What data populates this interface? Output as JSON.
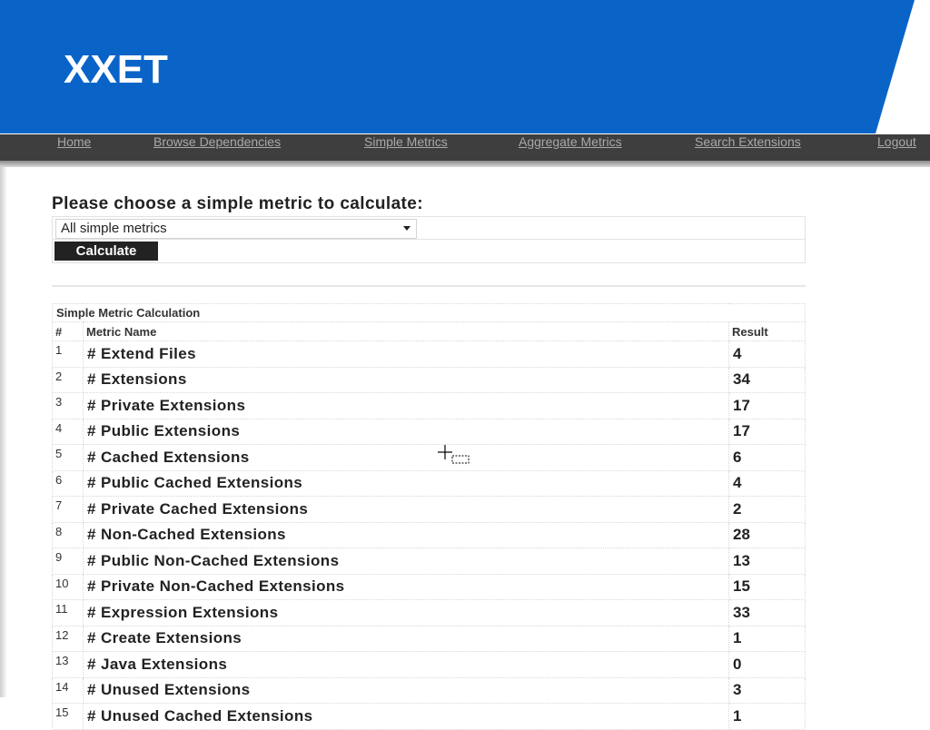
{
  "header": {
    "title": "XXET",
    "colors": {
      "banner": "#0a64c8",
      "navbar": "#3e3e3e"
    }
  },
  "nav": {
    "items": [
      {
        "label": "Home"
      },
      {
        "label": "Browse Dependencies"
      },
      {
        "label": "Simple Metrics"
      },
      {
        "label": "Aggregate Metrics"
      },
      {
        "label": "Search Extensions"
      },
      {
        "label": "Logout"
      }
    ]
  },
  "form": {
    "prompt": "Please choose a simple metric to calculate:",
    "select_value": "All simple metrics",
    "calculate_label": "Calculate"
  },
  "results": {
    "caption": "Simple Metric Calculation",
    "columns": [
      "#",
      "Metric Name",
      "Result"
    ],
    "rows": [
      {
        "num": "1",
        "name": "# Extend Files",
        "result": "4"
      },
      {
        "num": "2",
        "name": "# Extensions",
        "result": "34"
      },
      {
        "num": "3",
        "name": "# Private Extensions",
        "result": "17"
      },
      {
        "num": "4",
        "name": "# Public Extensions",
        "result": "17"
      },
      {
        "num": "5",
        "name": "# Cached Extensions",
        "result": "6"
      },
      {
        "num": "6",
        "name": "# Public Cached Extensions",
        "result": "4"
      },
      {
        "num": "7",
        "name": "# Private Cached Extensions",
        "result": "2"
      },
      {
        "num": "8",
        "name": "# Non-Cached Extensions",
        "result": "28"
      },
      {
        "num": "9",
        "name": "# Public Non-Cached Extensions",
        "result": "13"
      },
      {
        "num": "10",
        "name": "# Private Non-Cached Extensions",
        "result": "15"
      },
      {
        "num": "11",
        "name": "# Expression Extensions",
        "result": "33"
      },
      {
        "num": "12",
        "name": "# Create Extensions",
        "result": "1"
      },
      {
        "num": "13",
        "name": "# Java Extensions",
        "result": "0"
      },
      {
        "num": "14",
        "name": "# Unused Extensions",
        "result": "3"
      },
      {
        "num": "15",
        "name": "# Unused Cached Extensions",
        "result": "1"
      }
    ]
  }
}
